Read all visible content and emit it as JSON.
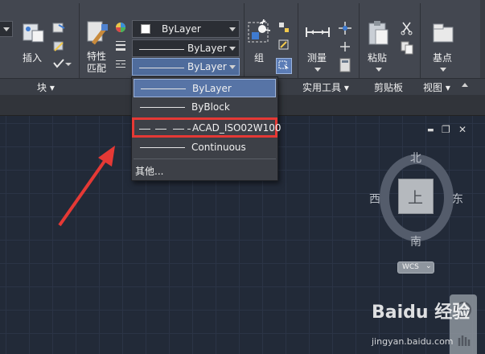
{
  "ribbon": {
    "insert_label": "插入",
    "properties_label": "特性\n匹配",
    "group_label": "组",
    "measure_label": "测量",
    "paste_label": "粘贴",
    "base_label": "基点",
    "panels": {
      "block": "块 ▾",
      "utilities": "实用工具 ▾",
      "clipboard": "剪贴板",
      "view": "视图 ▾"
    }
  },
  "properties": {
    "color_value": "ByLayer",
    "lineweight_value": "ByLayer",
    "linetype_value": "ByLayer"
  },
  "linetype_dropdown": {
    "items": [
      {
        "label": "ByLayer",
        "state": "selected"
      },
      {
        "label": "ByBlock",
        "state": "normal"
      },
      {
        "label": "ACAD_ISO02W100",
        "state": "highlighted"
      },
      {
        "label": "Continuous",
        "state": "normal"
      }
    ],
    "other_label": "其他..."
  },
  "viewcube": {
    "north": "北",
    "south": "南",
    "west": "西",
    "east": "东",
    "top_face": "上",
    "wcs_label": "WCS"
  },
  "window_controls": {
    "minimize": "▬",
    "restore": "❐",
    "close": "✕"
  },
  "watermark": {
    "logo": "Baidu 经验",
    "url": "jingyan.baidu.com"
  },
  "colors": {
    "accent": "#5774a6",
    "highlight_box": "#e53935",
    "arrow": "#e53935"
  }
}
